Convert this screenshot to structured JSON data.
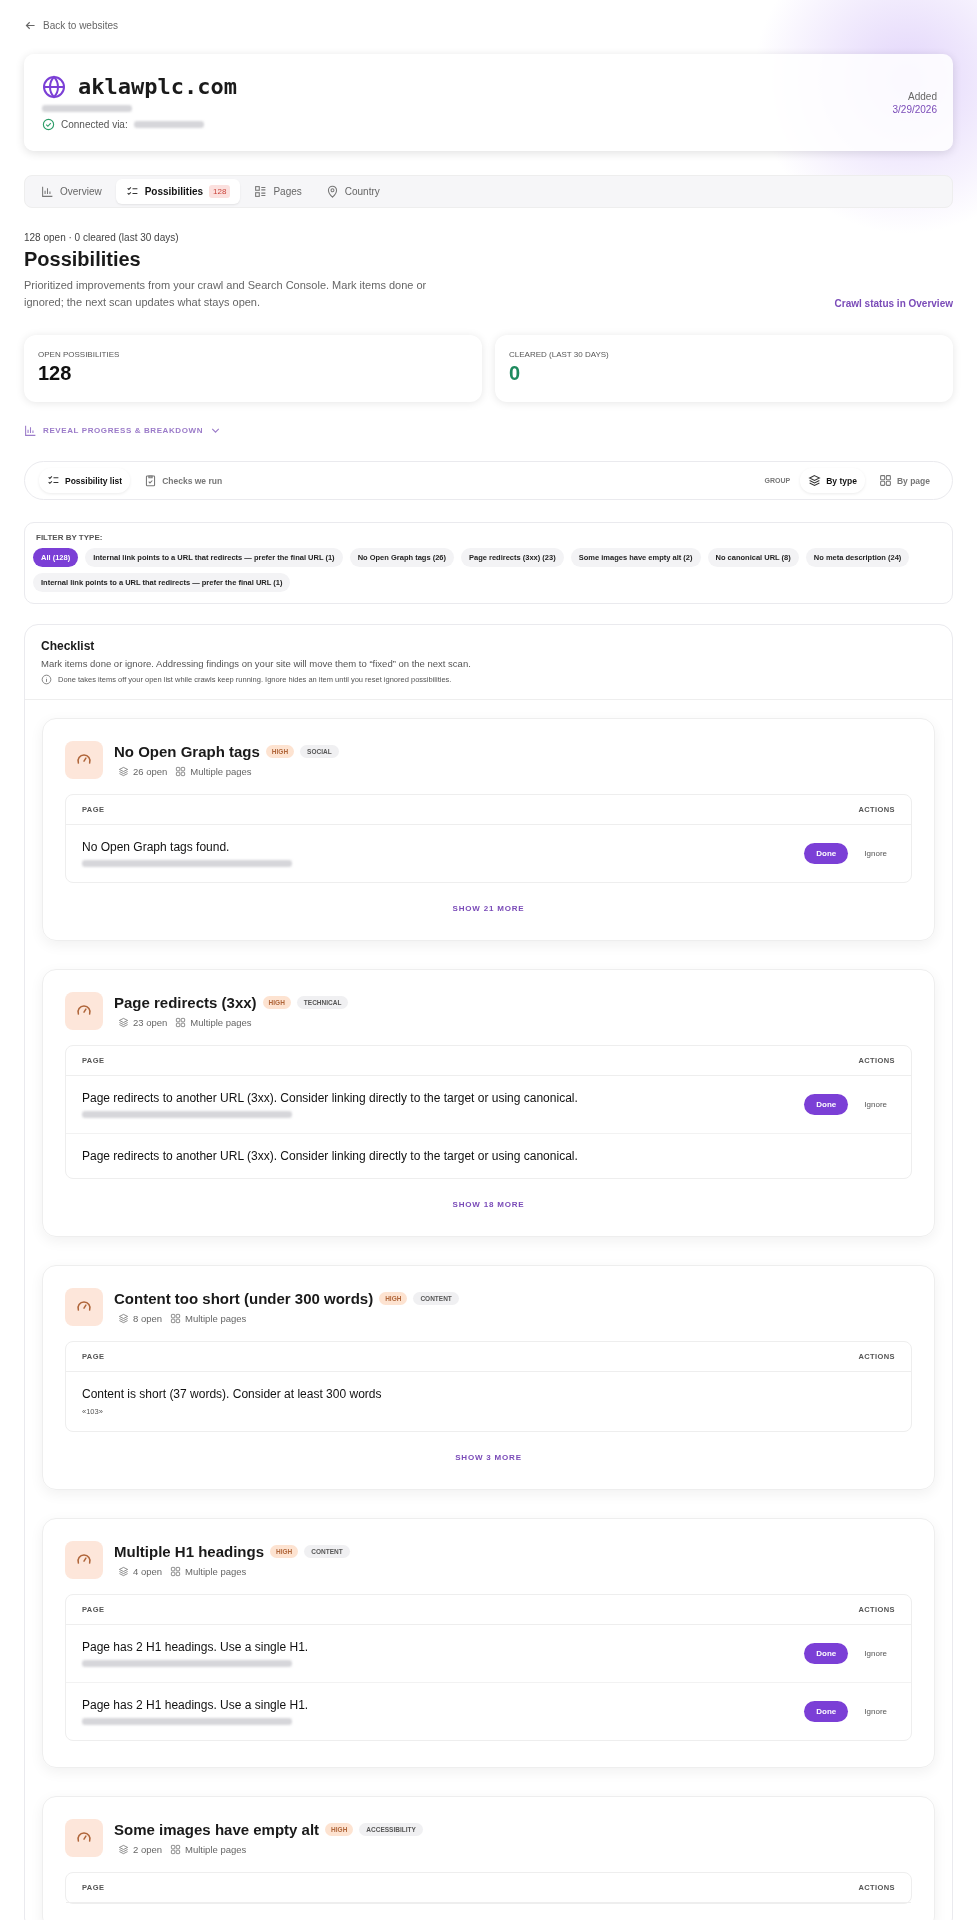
{
  "back_link": "Back to websites",
  "site": {
    "name": "aklawplc.com",
    "connected_label": "Connected via:",
    "added_label": "Added",
    "added_date": "3/29/2026"
  },
  "tabs": [
    {
      "label": "Overview",
      "selected": false
    },
    {
      "label": "Possibilities",
      "selected": true,
      "badge": "128"
    },
    {
      "label": "Pages",
      "selected": false
    },
    {
      "label": "Country",
      "selected": false
    }
  ],
  "summary": "128 open · 0 cleared (last 30 days)",
  "title": "Possibilities",
  "description": "Prioritized improvements from your crawl and Search Console. Mark items done or ignored; the next scan updates what stays open.",
  "crawl_link": "Crawl status in Overview",
  "stats": [
    {
      "label": "OPEN POSSIBILITIES",
      "value": "128",
      "kind": "neutral"
    },
    {
      "label": "CLEARED (LAST 30 DAYS)",
      "value": "0",
      "kind": "positive"
    }
  ],
  "reveal": "REVEAL PROGRESS & BREAKDOWN",
  "views": [
    {
      "label": "Possibility list",
      "selected": true
    },
    {
      "label": "Checks we run",
      "selected": false
    }
  ],
  "group": {
    "label": "GROUP",
    "options": [
      {
        "label": "By type",
        "selected": true
      },
      {
        "label": "By page",
        "selected": false
      }
    ]
  },
  "filter": {
    "label": "FILTER BY TYPE:",
    "chips": [
      {
        "label": "All (128)",
        "selected": true
      },
      {
        "label": "Internal link points to a URL that redirects — prefer the final URL (1)",
        "selected": false
      },
      {
        "label": "No Open Graph tags (26)",
        "selected": false
      },
      {
        "label": "Page redirects (3xx) (23)",
        "selected": false
      },
      {
        "label": "Some images have empty alt (2)",
        "selected": false
      },
      {
        "label": "No canonical URL (8)",
        "selected": false
      },
      {
        "label": "No meta description (24)",
        "selected": false
      },
      {
        "label": "Internal link points to a URL that redirects — prefer the final URL (1)",
        "selected": false
      }
    ]
  },
  "checklist": {
    "title": "Checklist",
    "description": "Mark items done or ignore. Addressing findings on your site will move them to “fixed” on the next scan.",
    "note": "Done takes items off your open list while crawls keep running. Ignore hides an item until you reset ignored possibilities.",
    "groups": [
      {
        "title": "No Open Graph tags",
        "priority": "HIGH",
        "category": "SOCIAL",
        "open": "26 open",
        "scope": "Multiple pages",
        "columns": [
          "PAGE",
          "ACTIONS"
        ],
        "rows": [
          {
            "message": "No Open Graph tags found.",
            "redacted": true,
            "actions": [
              "Done",
              "Ignore"
            ]
          }
        ],
        "show_more": "SHOW 21 MORE"
      },
      {
        "title": "Page redirects (3xx)",
        "priority": "HIGH",
        "category": "TECHNICAL",
        "open": "23 open",
        "scope": "Multiple pages",
        "columns": [
          "PAGE",
          "ACTIONS"
        ],
        "rows": [
          {
            "message": "Page redirects to another URL (3xx). Consider linking directly to the target or using canonical.",
            "redacted": true,
            "actions": [
              "Done",
              "Ignore"
            ]
          },
          {
            "message": "Page redirects to another URL (3xx). Consider linking directly to the target or using canonical.",
            "redacted": false
          }
        ],
        "show_more": "SHOW 18 MORE"
      },
      {
        "title": "Content too short (under 300 words)",
        "priority": "HIGH",
        "category": "CONTENT",
        "open": "8 open",
        "scope": "Multiple pages",
        "columns": [
          "PAGE",
          "ACTIONS"
        ],
        "rows": [
          {
            "message": "Content is short (37 words). Consider at least 300 words",
            "redacted": false,
            "details": [
              "«103»"
            ]
          }
        ],
        "show_more": "SHOW 3 MORE"
      },
      {
        "title": "Multiple H1 headings",
        "priority": "HIGH",
        "category": "CONTENT",
        "open": "4 open",
        "scope": "Multiple pages",
        "columns": [
          "PAGE",
          "ACTIONS"
        ],
        "rows": [
          {
            "message": "Page has 2 H1 headings. Use a single H1.",
            "redacted": true,
            "actions": [
              "Done",
              "Ignore"
            ]
          },
          {
            "message": "Page has 2 H1 headings. Use a single H1.",
            "redacted": true,
            "actions": [
              "Done",
              "Ignore"
            ]
          }
        ]
      },
      {
        "title": "Some images have empty alt",
        "priority": "HIGH",
        "category": "ACCESSIBILITY",
        "open": "2 open",
        "scope": "Multiple pages",
        "columns": [
          "PAGE",
          "ACTIONS"
        ]
      }
    ]
  }
}
